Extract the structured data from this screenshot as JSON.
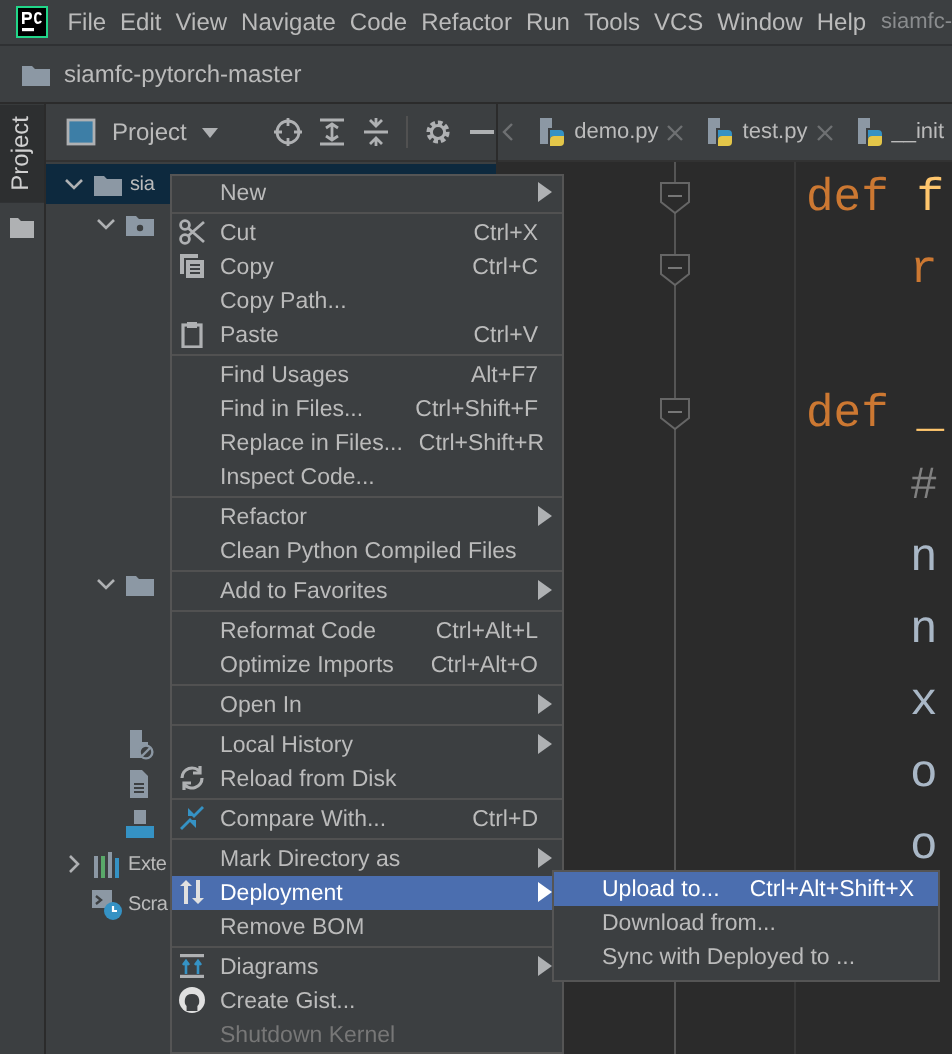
{
  "menu_bar": {
    "items": [
      "File",
      "Edit",
      "View",
      "Navigate",
      "Code",
      "Refactor",
      "Run",
      "Tools",
      "VCS",
      "Window",
      "Help"
    ],
    "window_title": "siamfc-"
  },
  "breadcrumb": {
    "label": "siamfc-pytorch-master"
  },
  "side_tabs": [
    {
      "label": "Project",
      "selected": true
    }
  ],
  "project_panel": {
    "view_label": "Project"
  },
  "tree": [
    {
      "label": "sia",
      "expanded": true,
      "selected": true,
      "children": [
        {
          "expanded": true,
          "selected": false
        },
        {
          "expanded": true,
          "selected": false
        },
        {
          "selected": false
        },
        {
          "selected": false
        },
        {
          "selected": false
        }
      ]
    },
    {
      "label": "Exte",
      "expanded": false,
      "selected": false
    },
    {
      "label": "Scra",
      "selected": false
    }
  ],
  "editor_tabs": [
    {
      "label": "demo.py",
      "selected": false,
      "closable": true
    },
    {
      "label": "test.py",
      "selected": false,
      "closable": true
    },
    {
      "label": "__init",
      "selected": false,
      "closable": false
    }
  ],
  "code_lines": [
    {
      "kind": "code",
      "indented": false,
      "fold": true,
      "segments": [
        {
          "text": "def ",
          "kind": "keyword"
        },
        {
          "text": "f",
          "kind": "function"
        }
      ]
    },
    {
      "kind": "code",
      "indented": true,
      "fold": true,
      "segments": [
        {
          "text": "r",
          "kind": "keyword"
        }
      ]
    },
    {
      "kind": "blank"
    },
    {
      "kind": "code",
      "indented": false,
      "fold": true,
      "segments": [
        {
          "text": "def ",
          "kind": "keyword"
        },
        {
          "text": "_",
          "kind": "function"
        }
      ]
    },
    {
      "kind": "code",
      "indented": true,
      "fold": false,
      "segments": [
        {
          "text": "# ",
          "kind": "comment"
        }
      ]
    },
    {
      "kind": "code",
      "indented": true,
      "fold": false,
      "segments": [
        {
          "text": "n",
          "kind": "name"
        }
      ]
    },
    {
      "kind": "code",
      "indented": true,
      "fold": false,
      "segments": [
        {
          "text": "n",
          "kind": "name"
        }
      ]
    },
    {
      "kind": "code",
      "indented": true,
      "fold": false,
      "segments": [
        {
          "text": "x ",
          "kind": "name"
        }
      ]
    },
    {
      "kind": "code",
      "indented": true,
      "fold": false,
      "segments": [
        {
          "text": "o",
          "kind": "name"
        }
      ]
    },
    {
      "kind": "code",
      "indented": true,
      "fold": false,
      "segments": [
        {
          "text": "o",
          "kind": "name"
        }
      ]
    }
  ],
  "context_menu": [
    {
      "kind": "item",
      "label": "New",
      "submenu": true,
      "selected": false,
      "disabled": false
    },
    {
      "kind": "separator"
    },
    {
      "kind": "item",
      "label": "Cut",
      "shortcut": "Ctrl+X",
      "submenu": false,
      "selected": false,
      "disabled": false
    },
    {
      "kind": "item",
      "label": "Copy",
      "shortcut": "Ctrl+C",
      "submenu": false,
      "selected": false,
      "disabled": false
    },
    {
      "kind": "item",
      "label": "Copy Path...",
      "submenu": false,
      "selected": false,
      "disabled": false
    },
    {
      "kind": "item",
      "label": "Paste",
      "shortcut": "Ctrl+V",
      "submenu": false,
      "selected": false,
      "disabled": false
    },
    {
      "kind": "separator"
    },
    {
      "kind": "item",
      "label": "Find Usages",
      "shortcut": "Alt+F7",
      "submenu": false,
      "selected": false,
      "disabled": false
    },
    {
      "kind": "item",
      "label": "Find in Files...",
      "shortcut": "Ctrl+Shift+F",
      "submenu": false,
      "selected": false,
      "disabled": false
    },
    {
      "kind": "item",
      "label": "Replace in Files...",
      "shortcut": "Ctrl+Shift+R",
      "submenu": false,
      "selected": false,
      "disabled": false
    },
    {
      "kind": "item",
      "label": "Inspect Code...",
      "submenu": false,
      "selected": false,
      "disabled": false
    },
    {
      "kind": "separator"
    },
    {
      "kind": "item",
      "label": "Refactor",
      "submenu": true,
      "selected": false,
      "disabled": false
    },
    {
      "kind": "item",
      "label": "Clean Python Compiled Files",
      "submenu": false,
      "selected": false,
      "disabled": false
    },
    {
      "kind": "separator"
    },
    {
      "kind": "item",
      "label": "Add to Favorites",
      "submenu": true,
      "selected": false,
      "disabled": false
    },
    {
      "kind": "separator"
    },
    {
      "kind": "item",
      "label": "Reformat Code",
      "shortcut": "Ctrl+Alt+L",
      "submenu": false,
      "selected": false,
      "disabled": false
    },
    {
      "kind": "item",
      "label": "Optimize Imports",
      "shortcut": "Ctrl+Alt+O",
      "submenu": false,
      "selected": false,
      "disabled": false
    },
    {
      "kind": "separator"
    },
    {
      "kind": "item",
      "label": "Open In",
      "submenu": true,
      "selected": false,
      "disabled": false
    },
    {
      "kind": "separator"
    },
    {
      "kind": "item",
      "label": "Local History",
      "submenu": true,
      "selected": false,
      "disabled": false
    },
    {
      "kind": "item",
      "label": "Reload from Disk",
      "submenu": false,
      "selected": false,
      "disabled": false
    },
    {
      "kind": "separator"
    },
    {
      "kind": "item",
      "label": "Compare With...",
      "shortcut": "Ctrl+D",
      "submenu": false,
      "selected": false,
      "disabled": false
    },
    {
      "kind": "separator"
    },
    {
      "kind": "item",
      "label": "Mark Directory as",
      "submenu": true,
      "selected": false,
      "disabled": false
    },
    {
      "kind": "item",
      "label": "Deployment",
      "submenu": true,
      "selected": true,
      "disabled": false
    },
    {
      "kind": "item",
      "label": "Remove BOM",
      "submenu": false,
      "selected": false,
      "disabled": false
    },
    {
      "kind": "separator"
    },
    {
      "kind": "item",
      "label": "Diagrams",
      "submenu": true,
      "selected": false,
      "disabled": false
    },
    {
      "kind": "item",
      "label": "Create Gist...",
      "submenu": false,
      "selected": false,
      "disabled": false
    },
    {
      "kind": "item",
      "label": "Shutdown Kernel",
      "submenu": false,
      "selected": false,
      "disabled": true
    }
  ],
  "submenu": [
    {
      "label": "Upload to...",
      "shortcut": "Ctrl+Alt+Shift+X",
      "selected": true
    },
    {
      "label": "Download from...",
      "selected": false
    },
    {
      "label": "Sync with Deployed to ...",
      "selected": false
    }
  ]
}
